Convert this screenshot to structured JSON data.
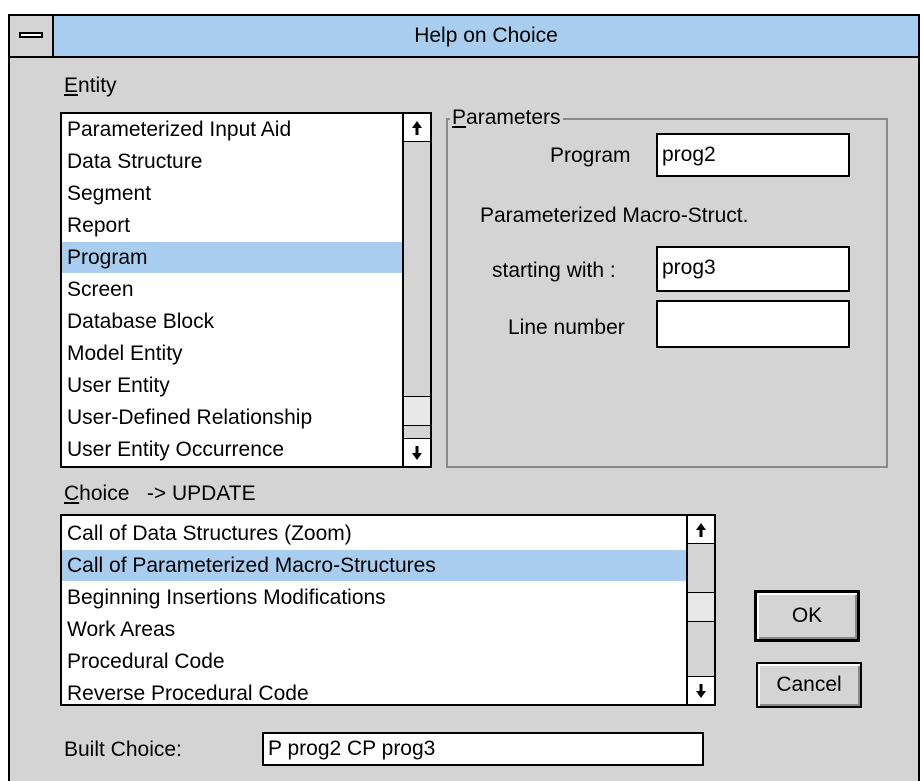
{
  "window": {
    "title": "Help on Choice"
  },
  "entity": {
    "label": "Entity",
    "items": [
      "Parameterized Input Aid",
      "Data Structure",
      "Segment",
      "Report",
      "Program",
      "Screen",
      "Database Block",
      "Model Entity",
      "User Entity",
      "User-Defined Relationship",
      "User Entity Occurrence"
    ],
    "selected_index": 4
  },
  "parameters": {
    "label": "Parameters",
    "program_label": "Program",
    "program_value": "prog2",
    "macro_label": "Parameterized Macro-Struct.",
    "starting_label": "starting with :",
    "starting_value": "prog3",
    "line_label": "Line number",
    "line_value": ""
  },
  "choice": {
    "label": "Choice",
    "mode": "-> UPDATE",
    "items": [
      "Call of Data Structures (Zoom)",
      "Call of Parameterized Macro-Structures",
      "Beginning Insertions Modifications",
      "Work Areas",
      "Procedural Code",
      "Reverse Procedural Code"
    ],
    "selected_index": 1
  },
  "built_choice": {
    "label": "Built Choice:",
    "value": "P prog2  CP prog3"
  },
  "buttons": {
    "ok": "OK",
    "cancel": "Cancel"
  },
  "colors": {
    "title_bar": "#a8cdee",
    "selection": "#a8cdee",
    "face": "#d4d4d4"
  }
}
